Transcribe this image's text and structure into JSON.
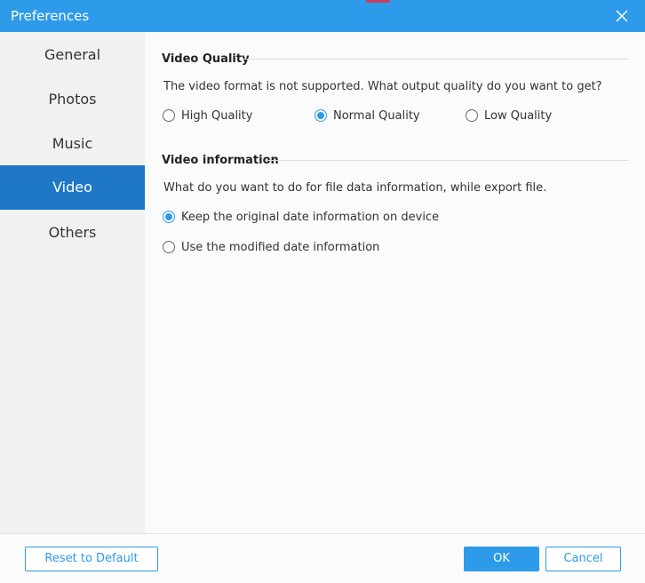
{
  "window": {
    "title": "Preferences"
  },
  "sidebar": {
    "items": [
      {
        "label": "General"
      },
      {
        "label": "Photos"
      },
      {
        "label": "Music"
      },
      {
        "label": "Video",
        "active": true
      },
      {
        "label": "Others"
      }
    ]
  },
  "video_quality": {
    "title": "Video Quality",
    "description": "The video format is not supported. What output quality do you want to get?",
    "options": [
      {
        "label": "High Quality",
        "checked": false
      },
      {
        "label": "Normal Quality",
        "checked": true
      },
      {
        "label": "Low Quality",
        "checked": false
      }
    ]
  },
  "video_information": {
    "title": "Video information",
    "description": "What do you want to do for file data information, while export file.",
    "options": [
      {
        "label": "Keep the original date information on device",
        "checked": true
      },
      {
        "label": "Use the modified date information",
        "checked": false
      }
    ]
  },
  "footer": {
    "reset_label": "Reset to Default",
    "ok_label": "OK",
    "cancel_label": "Cancel"
  },
  "colors": {
    "accent": "#2d9bea",
    "active_nav": "#1e78c6",
    "sidebar_bg": "#f1f1f1"
  }
}
